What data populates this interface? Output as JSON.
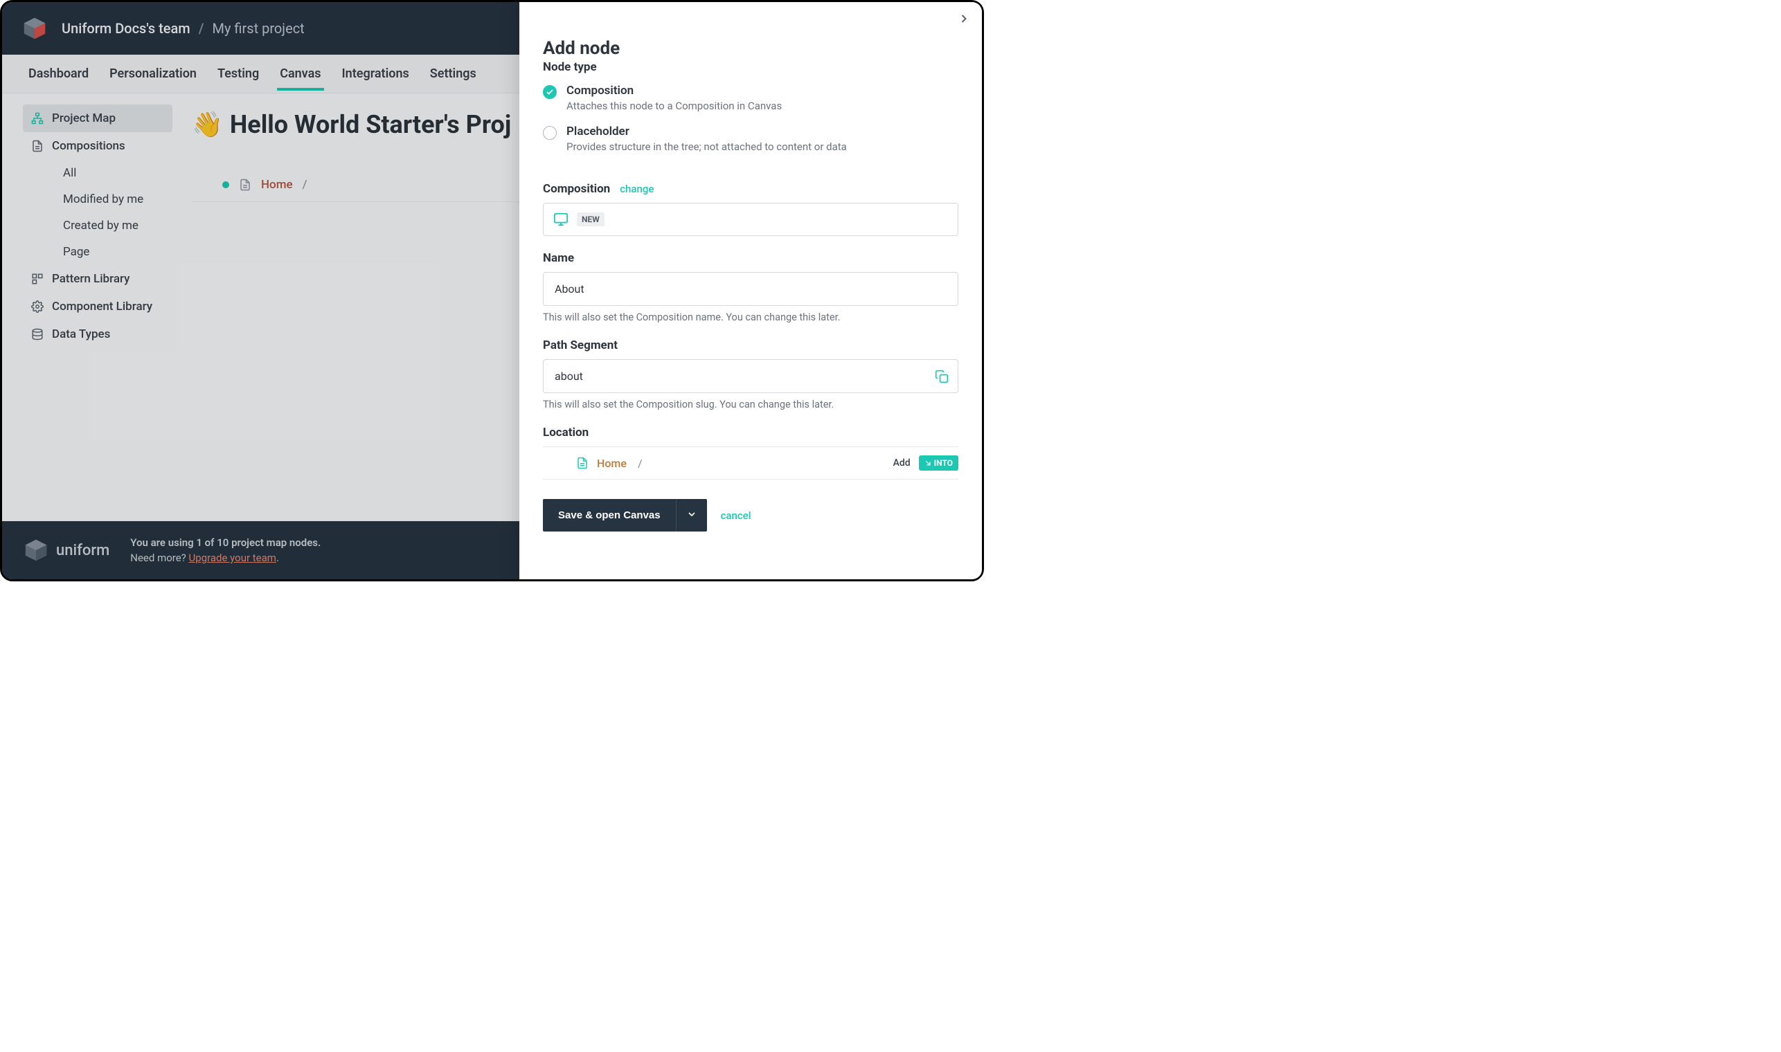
{
  "header": {
    "team": "Uniform Docs's team",
    "project": "My first project"
  },
  "tabs": [
    "Dashboard",
    "Personalization",
    "Testing",
    "Canvas",
    "Integrations",
    "Settings"
  ],
  "activeTab": "Canvas",
  "sidebar": {
    "primary": [
      {
        "label": "Project Map",
        "icon": "sitemap",
        "active": true
      },
      {
        "label": "Compositions",
        "icon": "document",
        "active": false
      }
    ],
    "compositionFilters": [
      "All",
      "Modified by me",
      "Created by me",
      "Page"
    ],
    "secondary": [
      {
        "label": "Pattern Library",
        "icon": "grid"
      },
      {
        "label": "Component Library",
        "icon": "gear"
      },
      {
        "label": "Data Types",
        "icon": "database"
      }
    ]
  },
  "content": {
    "titleEmoji": "👋",
    "title": "Hello World Starter's Proj",
    "tree": {
      "node": "Home",
      "sep": "/"
    }
  },
  "footer": {
    "brand": "uniform",
    "line1": "You are using 1 of 10 project map nodes.",
    "line2_prefix": "Need more? ",
    "line2_link": "Upgrade your team",
    "line2_suffix": "."
  },
  "panel": {
    "title": "Add node",
    "subtitle": "Node type",
    "nodeTypes": [
      {
        "label": "Composition",
        "desc": "Attaches this node to a Composition in Canvas",
        "checked": true
      },
      {
        "label": "Placeholder",
        "desc": "Provides structure in the tree; not attached to content or data",
        "checked": false
      }
    ],
    "compositionLabel": "Composition",
    "changeLabel": "change",
    "newBadge": "NEW",
    "nameLabel": "Name",
    "nameValue": "About",
    "nameHelp": "This will also set the Composition name. You can change this later.",
    "pathLabel": "Path Segment",
    "pathValue": "about",
    "pathHelp": "This will also set the Composition slug. You can change this later.",
    "locationLabel": "Location",
    "locationNode": "Home",
    "locationSep": "/",
    "addLabel": "Add",
    "intoLabel": "INTO",
    "saveLabel": "Save & open Canvas",
    "cancelLabel": "cancel"
  }
}
